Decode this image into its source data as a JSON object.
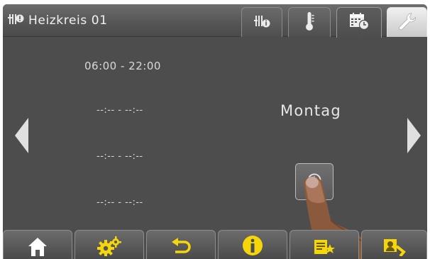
{
  "header": {
    "title": "Heizkreis 01",
    "title_icon": "heating-circuit-alert-icon",
    "tabs": [
      {
        "name": "info",
        "icon": "heating-circuit-info-icon",
        "state": "inactive"
      },
      {
        "name": "temperature",
        "icon": "thermometer-icon",
        "state": "inactive"
      },
      {
        "name": "schedule",
        "icon": "calendar-clock-icon",
        "state": "active"
      },
      {
        "name": "settings",
        "icon": "wrench-icon",
        "state": "inactive"
      }
    ]
  },
  "schedule": {
    "time_slots": [
      "06:00 - 22:00",
      "--:-- - --:--",
      "--:-- - --:--",
      "--:-- - --:--"
    ],
    "day": "Montag"
  },
  "toolbar": {
    "buttons": [
      {
        "name": "home",
        "icon": "home-icon"
      },
      {
        "name": "settings",
        "icon": "gears-icon"
      },
      {
        "name": "back",
        "icon": "back-arrow-icon"
      },
      {
        "name": "info",
        "icon": "info-icon"
      },
      {
        "name": "favorites",
        "icon": "list-star-icon"
      },
      {
        "name": "switch",
        "icon": "switch-user-icon"
      }
    ]
  },
  "colors": {
    "background": "#4d4d4d",
    "text": "#d9d9d9",
    "accent_yellow": "#f5d60a"
  }
}
